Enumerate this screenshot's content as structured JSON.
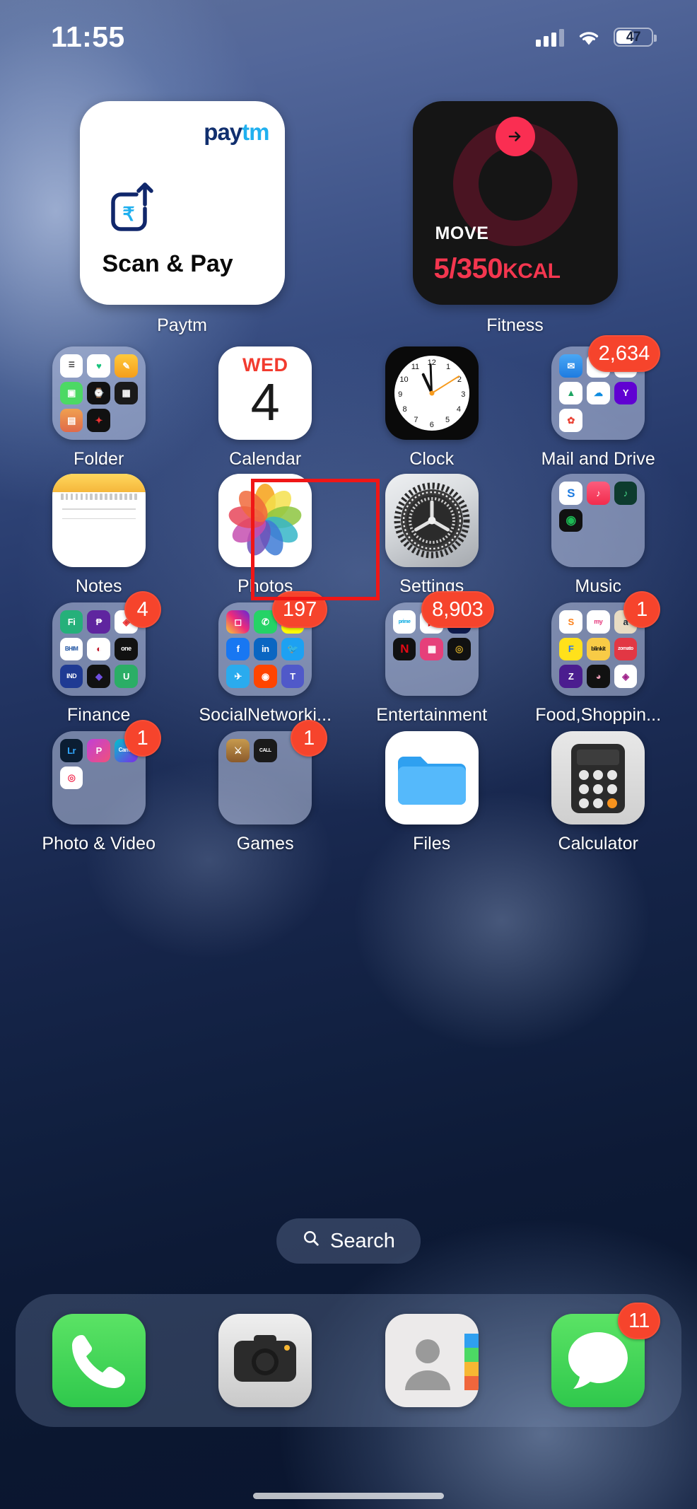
{
  "status_bar": {
    "time": "11:55",
    "battery_percent": "47",
    "signal_icon": "cellular-bars-icon",
    "wifi_icon": "wifi-icon",
    "battery_icon": "battery-icon"
  },
  "widgets": [
    {
      "name": "paytm",
      "brand_part1": "pay",
      "brand_part2": "tm",
      "title": "Scan & Pay",
      "icon": "rupee-scan-arrow-icon",
      "label": "Paytm",
      "background": "#ffffff"
    },
    {
      "name": "fitness",
      "metric_label": "MOVE",
      "metric_value": "5/350",
      "metric_unit": "KCAL",
      "arrow_icon": "arrow-right-icon",
      "label": "Fitness",
      "background": "#151515",
      "accent": "#F4364F"
    }
  ],
  "rows": [
    {
      "items": [
        {
          "label": "Folder",
          "type": "folder",
          "badge": null,
          "mini_apps": [
            "Reminders",
            "Health",
            "Notes",
            "FaceTime",
            "Watch",
            "Shortcuts",
            "Wallet",
            "Compass"
          ]
        },
        {
          "label": "Calendar",
          "type": "app",
          "badge": null,
          "calendar_dow": "WED",
          "calendar_day": "4"
        },
        {
          "label": "Clock",
          "type": "app",
          "badge": null
        },
        {
          "label": "Mail and Drive",
          "type": "folder",
          "badge": "2,634",
          "mini_apps": [
            "Mail",
            "Outlook",
            "Gmail",
            "Drive",
            "OneDrive",
            "Yahoo",
            "Photos"
          ]
        }
      ]
    },
    {
      "items": [
        {
          "label": "Notes",
          "type": "app",
          "badge": null
        },
        {
          "label": "Photos",
          "type": "app",
          "badge": null
        },
        {
          "label": "Settings",
          "type": "app",
          "badge": null,
          "highlighted": true
        },
        {
          "label": "Music",
          "type": "folder",
          "badge": null,
          "mini_apps": [
            "Shazam",
            "Apple Music",
            "Wynk",
            "Spotify"
          ]
        }
      ]
    },
    {
      "items": [
        {
          "label": "Finance",
          "type": "folder",
          "badge": "4",
          "mini_apps": [
            "Fi",
            "PhonePe",
            "CRED",
            "BHIM",
            "IDFC",
            "OneCard",
            "INDmoney",
            "Upstox"
          ]
        },
        {
          "label": "SocialNetworki...",
          "type": "folder",
          "badge": "197",
          "mini_apps": [
            "Instagram",
            "WhatsApp",
            "Snapchat",
            "Facebook",
            "LinkedIn",
            "Twitter",
            "Telegram",
            "Reddit",
            "Teams"
          ]
        },
        {
          "label": "Entertainment",
          "type": "folder",
          "badge": "8,903",
          "mini_apps": [
            "Prime Video",
            "YouTube",
            "Hotstar",
            "Netflix",
            "JioCinema",
            "Zee5"
          ]
        },
        {
          "label": "Food,Shoppin...",
          "type": "folder",
          "badge": "1",
          "mini_apps": [
            "Swiggy",
            "Myntra",
            "Amazon",
            "Flipkart",
            "Blinkit",
            "Zomato",
            "Zepto",
            "Nykaa",
            "Meesho"
          ]
        }
      ]
    },
    {
      "items": [
        {
          "label": "Photo & Video",
          "type": "folder",
          "badge": "1",
          "mini_apps": [
            "Lightroom",
            "Picsart",
            "Canva",
            "InShot"
          ]
        },
        {
          "label": "Games",
          "type": "folder",
          "badge": "1",
          "mini_apps": [
            "Clash of Clans",
            "Call of Duty"
          ]
        },
        {
          "label": "Files",
          "type": "app",
          "badge": null
        },
        {
          "label": "Calculator",
          "type": "app",
          "badge": null
        }
      ]
    }
  ],
  "search": {
    "label": "Search",
    "icon": "magnifier-icon"
  },
  "dock": {
    "items": [
      {
        "label": "Phone",
        "icon": "phone-icon",
        "badge": null,
        "color": "#4CD964"
      },
      {
        "label": "Camera",
        "icon": "camera-icon",
        "badge": null,
        "color": "#3a3a3c"
      },
      {
        "label": "Contacts",
        "icon": "contacts-icon",
        "badge": null,
        "color": "#e8e8e8"
      },
      {
        "label": "Messages",
        "icon": "message-bubble-icon",
        "badge": "11",
        "color": "#4CD964"
      }
    ]
  },
  "highlight": {
    "target": "Settings",
    "color": "#F01616"
  }
}
